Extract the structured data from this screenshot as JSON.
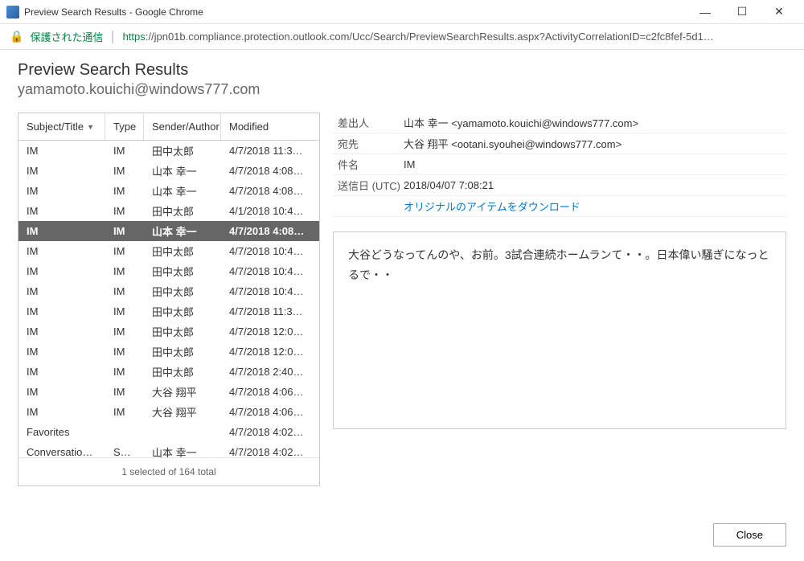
{
  "window": {
    "title": "Preview Search Results - Google Chrome"
  },
  "addressbar": {
    "secure_label": "保護された通信",
    "url_prefix": "https",
    "url_rest": "://jpn01b.compliance.protection.outlook.com/Ucc/Search/PreviewSearchResults.aspx?ActivityCorrelationID=c2fc8fef-5d1…"
  },
  "header": {
    "title": "Preview Search Results",
    "subtitle": "yamamoto.kouichi@windows777.com"
  },
  "table": {
    "columns": {
      "subject": "Subject/Title",
      "type": "Type",
      "sender": "Sender/Author",
      "modified": "Modified"
    },
    "rows": [
      {
        "subject": "IM",
        "type": "IM",
        "sender": "田中太郎",
        "modified": "4/7/2018 11:3…",
        "selected": false
      },
      {
        "subject": "IM",
        "type": "IM",
        "sender": "山本 幸一",
        "modified": "4/7/2018 4:08…",
        "selected": false
      },
      {
        "subject": "IM",
        "type": "IM",
        "sender": "山本 幸一",
        "modified": "4/7/2018 4:08…",
        "selected": false
      },
      {
        "subject": "IM",
        "type": "IM",
        "sender": "田中太郎",
        "modified": "4/1/2018 10:4…",
        "selected": false
      },
      {
        "subject": "IM",
        "type": "IM",
        "sender": "山本 幸一",
        "modified": "4/7/2018 4:08…",
        "selected": true
      },
      {
        "subject": "IM",
        "type": "IM",
        "sender": "田中太郎",
        "modified": "4/7/2018 10:4…",
        "selected": false
      },
      {
        "subject": "IM",
        "type": "IM",
        "sender": "田中太郎",
        "modified": "4/7/2018 10:4…",
        "selected": false
      },
      {
        "subject": "IM",
        "type": "IM",
        "sender": "田中太郎",
        "modified": "4/7/2018 10:4…",
        "selected": false
      },
      {
        "subject": "IM",
        "type": "IM",
        "sender": "田中太郎",
        "modified": "4/7/2018 11:3…",
        "selected": false
      },
      {
        "subject": "IM",
        "type": "IM",
        "sender": "田中太郎",
        "modified": "4/7/2018 12:0…",
        "selected": false
      },
      {
        "subject": "IM",
        "type": "IM",
        "sender": "田中太郎",
        "modified": "4/7/2018 12:0…",
        "selected": false
      },
      {
        "subject": "IM",
        "type": "IM",
        "sender": "田中太郎",
        "modified": "4/7/2018 2:40…",
        "selected": false
      },
      {
        "subject": "IM",
        "type": "IM",
        "sender": "大谷 翔平",
        "modified": "4/7/2018 4:06…",
        "selected": false
      },
      {
        "subject": "IM",
        "type": "IM",
        "sender": "大谷 翔平",
        "modified": "4/7/2018 4:06…",
        "selected": false
      },
      {
        "subject": "Favorites",
        "type": "",
        "sender": "",
        "modified": "4/7/2018 4:02…",
        "selected": false
      },
      {
        "subject": "Conversation …",
        "type": "Sky…",
        "sender": "山本 幸一",
        "modified": "4/7/2018 4:02…",
        "selected": false
      }
    ],
    "footer": "1 selected of 164 total"
  },
  "detail": {
    "labels": {
      "from": "差出人",
      "to": "宛先",
      "subject": "件名",
      "sent": "送信日 (UTC)"
    },
    "from": "山本 幸一 <yamamoto.kouichi@windows777.com>",
    "to": "大谷 翔平 <ootani.syouhei@windows777.com>",
    "subject": "IM",
    "sent": "2018/04/07 7:08:21",
    "download_link": "オリジナルのアイテムをダウンロード",
    "body": "大谷どうなってんのや、お前。3試合連続ホームランて・・。日本偉い騒ぎになっとるで・・"
  },
  "buttons": {
    "close": "Close"
  }
}
